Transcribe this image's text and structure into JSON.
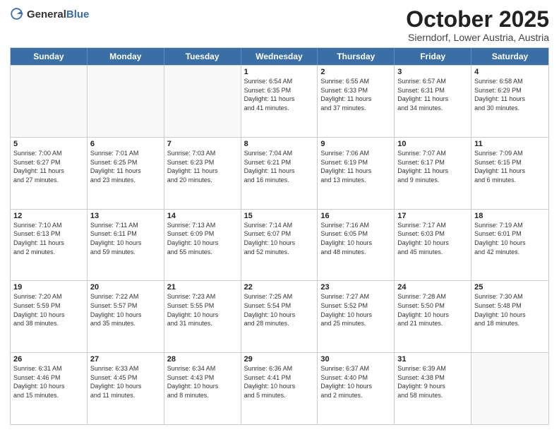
{
  "header": {
    "logo_general": "General",
    "logo_blue": "Blue",
    "month": "October 2025",
    "location": "Sierndorf, Lower Austria, Austria"
  },
  "days_of_week": [
    "Sunday",
    "Monday",
    "Tuesday",
    "Wednesday",
    "Thursday",
    "Friday",
    "Saturday"
  ],
  "weeks": [
    [
      {
        "date": "",
        "info": ""
      },
      {
        "date": "",
        "info": ""
      },
      {
        "date": "",
        "info": ""
      },
      {
        "date": "1",
        "info": "Sunrise: 6:54 AM\nSunset: 6:35 PM\nDaylight: 11 hours\nand 41 minutes."
      },
      {
        "date": "2",
        "info": "Sunrise: 6:55 AM\nSunset: 6:33 PM\nDaylight: 11 hours\nand 37 minutes."
      },
      {
        "date": "3",
        "info": "Sunrise: 6:57 AM\nSunset: 6:31 PM\nDaylight: 11 hours\nand 34 minutes."
      },
      {
        "date": "4",
        "info": "Sunrise: 6:58 AM\nSunset: 6:29 PM\nDaylight: 11 hours\nand 30 minutes."
      }
    ],
    [
      {
        "date": "5",
        "info": "Sunrise: 7:00 AM\nSunset: 6:27 PM\nDaylight: 11 hours\nand 27 minutes."
      },
      {
        "date": "6",
        "info": "Sunrise: 7:01 AM\nSunset: 6:25 PM\nDaylight: 11 hours\nand 23 minutes."
      },
      {
        "date": "7",
        "info": "Sunrise: 7:03 AM\nSunset: 6:23 PM\nDaylight: 11 hours\nand 20 minutes."
      },
      {
        "date": "8",
        "info": "Sunrise: 7:04 AM\nSunset: 6:21 PM\nDaylight: 11 hours\nand 16 minutes."
      },
      {
        "date": "9",
        "info": "Sunrise: 7:06 AM\nSunset: 6:19 PM\nDaylight: 11 hours\nand 13 minutes."
      },
      {
        "date": "10",
        "info": "Sunrise: 7:07 AM\nSunset: 6:17 PM\nDaylight: 11 hours\nand 9 minutes."
      },
      {
        "date": "11",
        "info": "Sunrise: 7:09 AM\nSunset: 6:15 PM\nDaylight: 11 hours\nand 6 minutes."
      }
    ],
    [
      {
        "date": "12",
        "info": "Sunrise: 7:10 AM\nSunset: 6:13 PM\nDaylight: 11 hours\nand 2 minutes."
      },
      {
        "date": "13",
        "info": "Sunrise: 7:11 AM\nSunset: 6:11 PM\nDaylight: 10 hours\nand 59 minutes."
      },
      {
        "date": "14",
        "info": "Sunrise: 7:13 AM\nSunset: 6:09 PM\nDaylight: 10 hours\nand 55 minutes."
      },
      {
        "date": "15",
        "info": "Sunrise: 7:14 AM\nSunset: 6:07 PM\nDaylight: 10 hours\nand 52 minutes."
      },
      {
        "date": "16",
        "info": "Sunrise: 7:16 AM\nSunset: 6:05 PM\nDaylight: 10 hours\nand 48 minutes."
      },
      {
        "date": "17",
        "info": "Sunrise: 7:17 AM\nSunset: 6:03 PM\nDaylight: 10 hours\nand 45 minutes."
      },
      {
        "date": "18",
        "info": "Sunrise: 7:19 AM\nSunset: 6:01 PM\nDaylight: 10 hours\nand 42 minutes."
      }
    ],
    [
      {
        "date": "19",
        "info": "Sunrise: 7:20 AM\nSunset: 5:59 PM\nDaylight: 10 hours\nand 38 minutes."
      },
      {
        "date": "20",
        "info": "Sunrise: 7:22 AM\nSunset: 5:57 PM\nDaylight: 10 hours\nand 35 minutes."
      },
      {
        "date": "21",
        "info": "Sunrise: 7:23 AM\nSunset: 5:55 PM\nDaylight: 10 hours\nand 31 minutes."
      },
      {
        "date": "22",
        "info": "Sunrise: 7:25 AM\nSunset: 5:54 PM\nDaylight: 10 hours\nand 28 minutes."
      },
      {
        "date": "23",
        "info": "Sunrise: 7:27 AM\nSunset: 5:52 PM\nDaylight: 10 hours\nand 25 minutes."
      },
      {
        "date": "24",
        "info": "Sunrise: 7:28 AM\nSunset: 5:50 PM\nDaylight: 10 hours\nand 21 minutes."
      },
      {
        "date": "25",
        "info": "Sunrise: 7:30 AM\nSunset: 5:48 PM\nDaylight: 10 hours\nand 18 minutes."
      }
    ],
    [
      {
        "date": "26",
        "info": "Sunrise: 6:31 AM\nSunset: 4:46 PM\nDaylight: 10 hours\nand 15 minutes."
      },
      {
        "date": "27",
        "info": "Sunrise: 6:33 AM\nSunset: 4:45 PM\nDaylight: 10 hours\nand 11 minutes."
      },
      {
        "date": "28",
        "info": "Sunrise: 6:34 AM\nSunset: 4:43 PM\nDaylight: 10 hours\nand 8 minutes."
      },
      {
        "date": "29",
        "info": "Sunrise: 6:36 AM\nSunset: 4:41 PM\nDaylight: 10 hours\nand 5 minutes."
      },
      {
        "date": "30",
        "info": "Sunrise: 6:37 AM\nSunset: 4:40 PM\nDaylight: 10 hours\nand 2 minutes."
      },
      {
        "date": "31",
        "info": "Sunrise: 6:39 AM\nSunset: 4:38 PM\nDaylight: 9 hours\nand 58 minutes."
      },
      {
        "date": "",
        "info": ""
      }
    ]
  ]
}
